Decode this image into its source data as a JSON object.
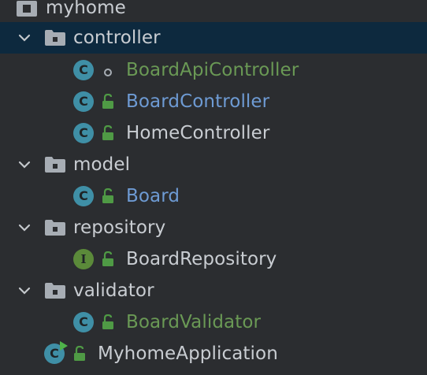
{
  "tree": {
    "root": {
      "label": "myhome"
    },
    "controller": {
      "label": "controller",
      "children": [
        {
          "label": "BoardApiController",
          "badge": "C"
        },
        {
          "label": "BoardController",
          "badge": "C"
        },
        {
          "label": "HomeController",
          "badge": "C"
        }
      ]
    },
    "model": {
      "label": "model",
      "children": [
        {
          "label": "Board",
          "badge": "C"
        }
      ]
    },
    "repository": {
      "label": "repository",
      "children": [
        {
          "label": "BoardRepository",
          "badge": "I"
        }
      ]
    },
    "validator": {
      "label": "validator",
      "children": [
        {
          "label": "BoardValidator",
          "badge": "C"
        }
      ]
    },
    "app": {
      "label": "MyhomeApplication",
      "badge": "C"
    }
  },
  "colors": {
    "background": "#2b2d30",
    "selected_row": "#0d293e",
    "default_text": "#c9cdd2",
    "modified_text": "#6e9bd4",
    "added_text": "#6a9955",
    "class_badge": "#3f8fa6",
    "interface_badge": "#5b8a3a",
    "lock_green": "#4f9a45"
  },
  "icons": [
    "package-icon",
    "folder-icon",
    "class-icon",
    "interface-icon",
    "lock-icon",
    "run-indicator-icon",
    "chevron-down-icon"
  ]
}
